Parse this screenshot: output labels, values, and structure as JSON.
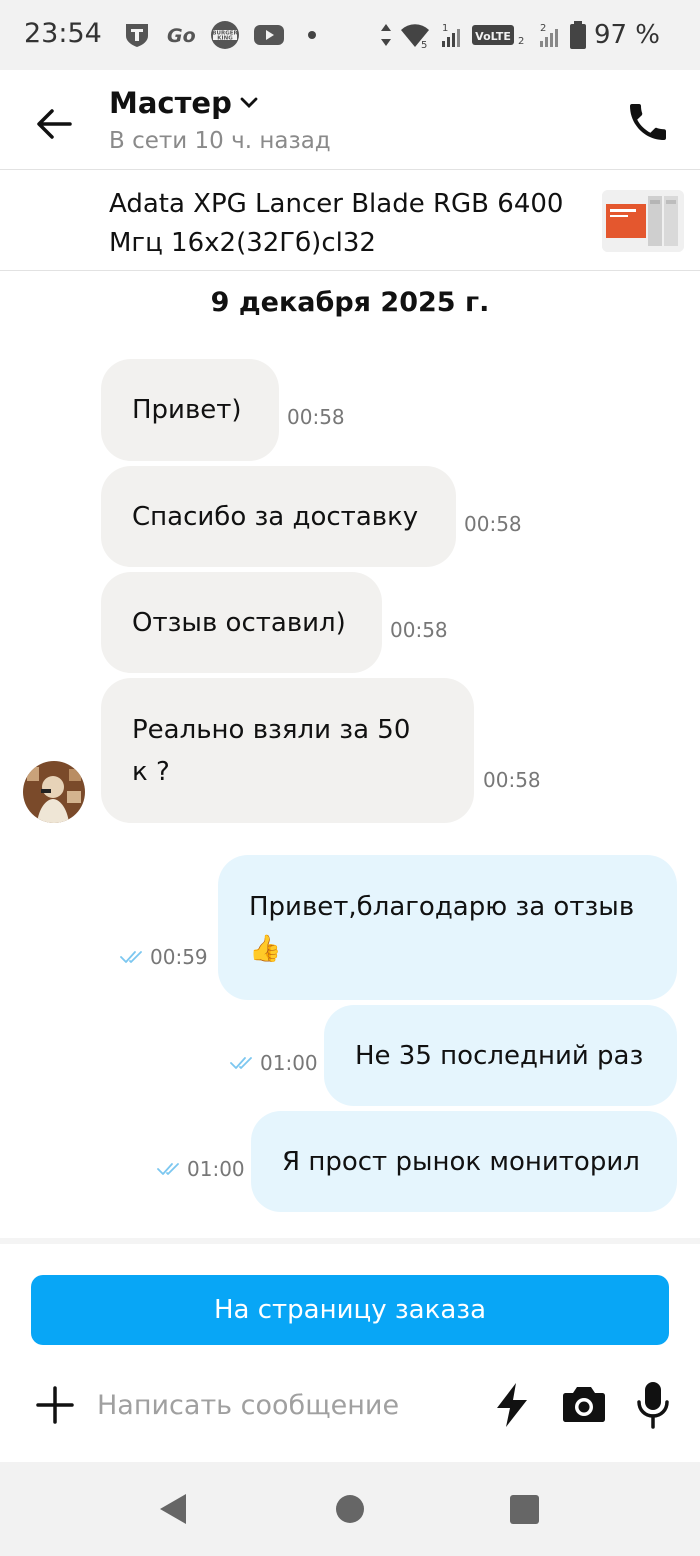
{
  "status_bar": {
    "time": "23:54",
    "battery": "97 %",
    "apps": [
      "tbank-icon",
      "go-icon",
      "burger-king-icon",
      "youtube-icon"
    ]
  },
  "header": {
    "name": "Мастер",
    "status": "В сети 10 ч. назад"
  },
  "product": {
    "title": "Adata XPG Lancer Blade RGB 6400 Мгц 16x2(32Гб)cl32"
  },
  "date_separator": "9 декабря 2025 г.",
  "messages": [
    {
      "direction": "in",
      "text": "Привет)",
      "time": "00:58"
    },
    {
      "direction": "in",
      "text": "Спасибо за доставку",
      "time": "00:58"
    },
    {
      "direction": "in",
      "text": "Отзыв оставил)",
      "time": "00:58"
    },
    {
      "direction": "in",
      "line1": "Реально взяли за 50",
      "line2": "к ?",
      "time": "00:58"
    },
    {
      "direction": "out",
      "line1": "Привет,благодарю за отзыв",
      "line2": "👍",
      "time": "00:59",
      "read": true
    },
    {
      "direction": "out",
      "text": "Не 35 последний раз",
      "time": "01:00",
      "read": true
    },
    {
      "direction": "out",
      "text": "Я прост рынок мониторил",
      "time": "01:00",
      "read": true
    }
  ],
  "order_button": "На страницу заказа",
  "composer": {
    "placeholder": "Написать сообщение"
  },
  "colors": {
    "accent": "#08a6f6",
    "incoming_bubble": "#f2f1ef",
    "outgoing_bubble": "#e5f5fd",
    "read_ticks": "#7cc7f0"
  }
}
